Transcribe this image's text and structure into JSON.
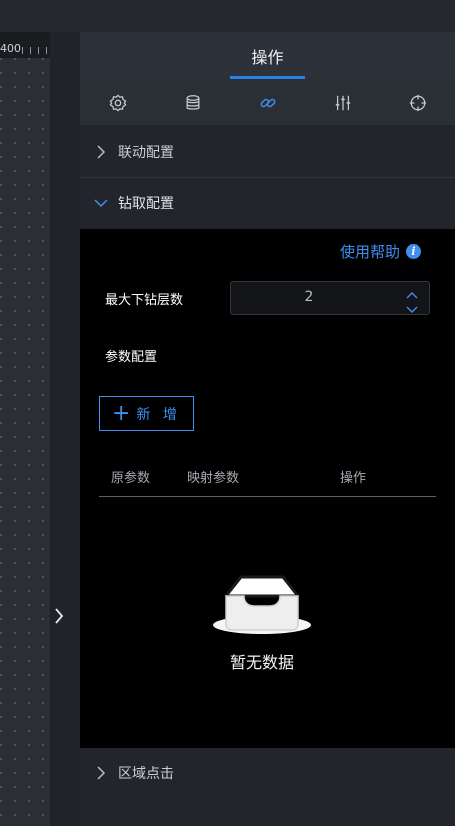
{
  "ruler": {
    "label": "400"
  },
  "panel": {
    "title": "操作",
    "tabs": [
      {
        "icon": "gear-icon"
      },
      {
        "icon": "database-icon"
      },
      {
        "icon": "link-icon",
        "active": true
      },
      {
        "icon": "sliders-icon"
      },
      {
        "icon": "crosshair-icon"
      }
    ],
    "sections": {
      "linkage": "联动配置",
      "drill": "钻取配置",
      "region_click": "区域点击"
    },
    "drill": {
      "help_label": "使用帮助",
      "max_depth_label": "最大下钻层数",
      "max_depth_value": "2",
      "params_label": "参数配置",
      "add_label": "新 增",
      "table_headers": [
        "原参数",
        "映射参数",
        "操作"
      ],
      "empty_text": "暂无数据"
    }
  },
  "colors": {
    "accent": "#3f8ef0",
    "panel_bg": "#22262c",
    "body_bg": "#000000"
  }
}
